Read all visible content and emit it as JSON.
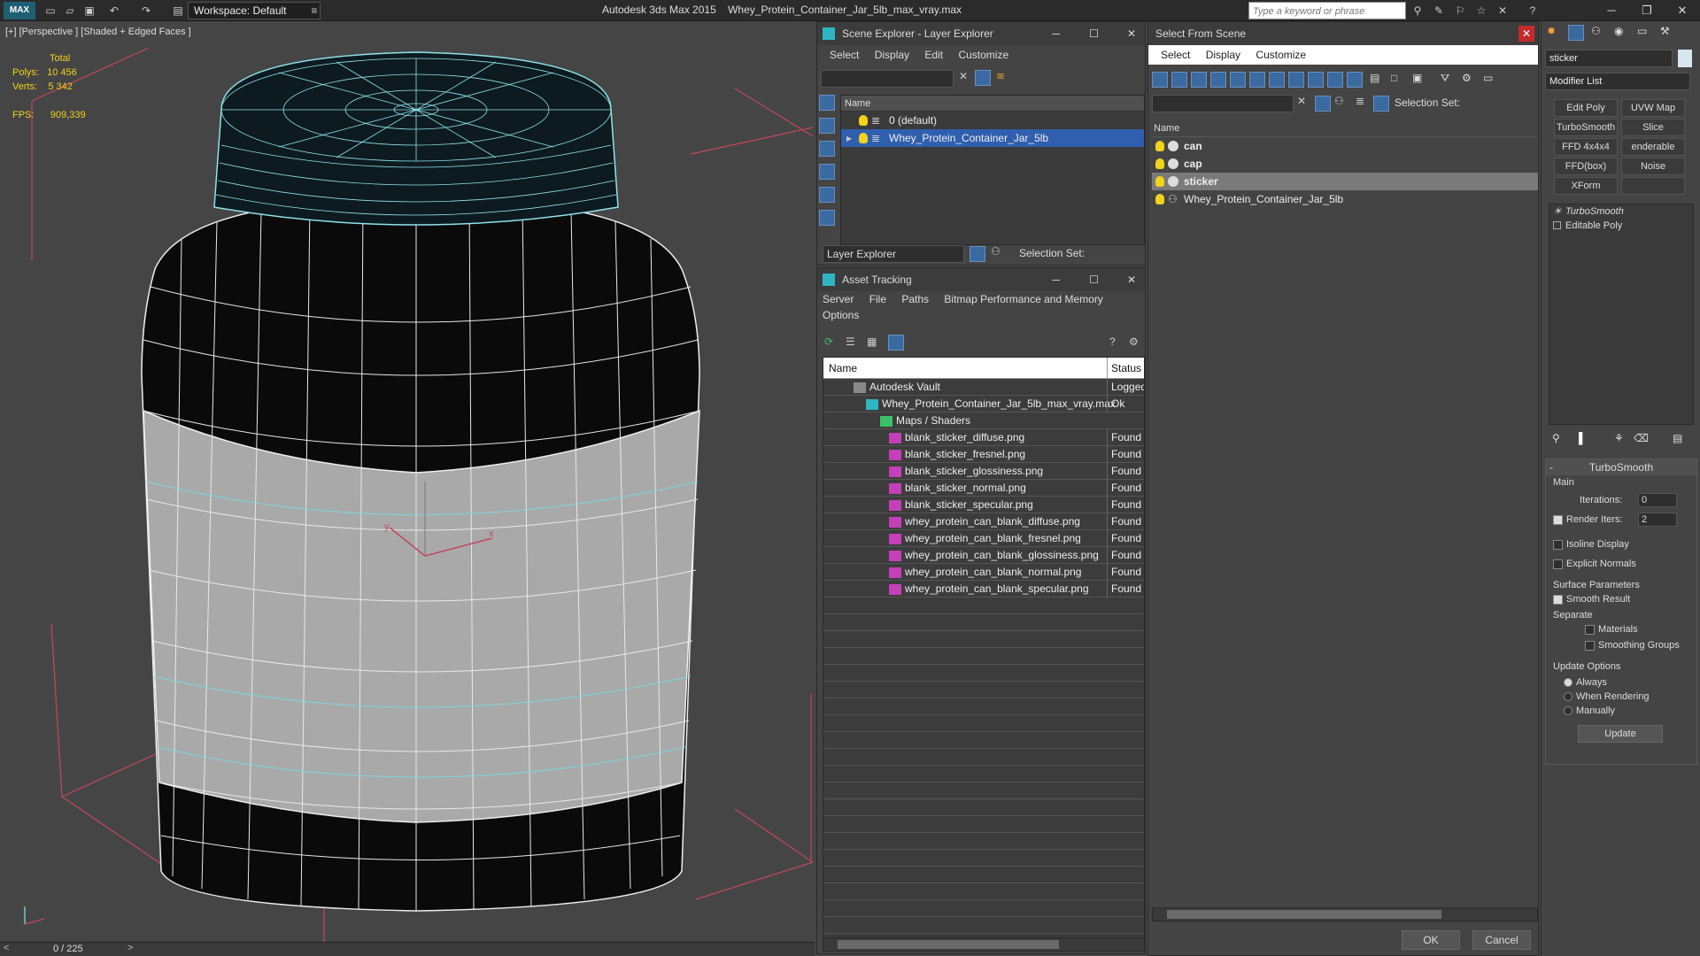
{
  "titlebar": {
    "logo": "MAX",
    "workspace": "Workspace: Default",
    "app": "Autodesk 3ds Max  2015",
    "file": "Whey_Protein_Container_Jar_5lb_max_vray.max",
    "search_placeholder": "Type a keyword or phrase"
  },
  "viewport": {
    "label": "[+] [Perspective ] [Shaded + Edged Faces ]",
    "stats_total": "Total",
    "polys_label": "Polys:",
    "polys_value": "10 456",
    "verts_label": "Verts:",
    "verts_value": "5 342",
    "fps_label": "FPS:",
    "fps_value": "909,339",
    "axis_x": "x",
    "axis_y": "y"
  },
  "timeline": {
    "frame": "0 / 225"
  },
  "scene_explorer": {
    "title": "Scene Explorer - Layer Explorer",
    "menu": [
      "Select",
      "Display",
      "Edit",
      "Customize"
    ],
    "column": "Name",
    "rows": [
      "0 (default)",
      "Whey_Protein_Container_Jar_5lb"
    ],
    "bottom_label": "Layer Explorer",
    "selection_set": "Selection Set:"
  },
  "asset_tracking": {
    "title": "Asset Tracking",
    "menu": [
      "Server",
      "File",
      "Paths",
      "Bitmap Performance and Memory"
    ],
    "menu2": "Options",
    "col_name": "Name",
    "col_status": "Status",
    "rows": [
      {
        "name": "Autodesk Vault",
        "status": "Logged",
        "indent": 34
      },
      {
        "name": "Whey_Protein_Container_Jar_5lb_max_vray.max",
        "status": "Ok",
        "indent": 48
      },
      {
        "name": "Maps / Shaders",
        "status": "",
        "indent": 64
      },
      {
        "name": "blank_sticker_diffuse.png",
        "status": "Found",
        "indent": 74
      },
      {
        "name": "blank_sticker_fresnel.png",
        "status": "Found",
        "indent": 74
      },
      {
        "name": "blank_sticker_glossiness.png",
        "status": "Found",
        "indent": 74
      },
      {
        "name": "blank_sticker_normal.png",
        "status": "Found",
        "indent": 74
      },
      {
        "name": "blank_sticker_specular.png",
        "status": "Found",
        "indent": 74
      },
      {
        "name": "whey_protein_can_blank_diffuse.png",
        "status": "Found",
        "indent": 74
      },
      {
        "name": "whey_protein_can_blank_fresnel.png",
        "status": "Found",
        "indent": 74
      },
      {
        "name": "whey_protein_can_blank_glossiness.png",
        "status": "Found",
        "indent": 74
      },
      {
        "name": "whey_protein_can_blank_normal.png",
        "status": "Found",
        "indent": 74
      },
      {
        "name": "whey_protein_can_blank_specular.png",
        "status": "Found",
        "indent": 74
      }
    ]
  },
  "select_from_scene": {
    "title": "Select From Scene",
    "menu": [
      "Select",
      "Display",
      "Customize"
    ],
    "selection_set": "Selection Set:",
    "column": "Name",
    "rows": [
      "can",
      "cap",
      "sticker",
      "Whey_Protein_Container_Jar_5lb"
    ],
    "ok": "OK",
    "cancel": "Cancel"
  },
  "command_panel": {
    "object_name": "sticker",
    "modifier_list": "Modifier List",
    "buttons": [
      "Edit Poly",
      "UVW Map",
      "TurboSmooth",
      "Slice",
      "FFD 4x4x4",
      "enderable Splir",
      "FFD(box)",
      "Noise",
      "XForm",
      ""
    ],
    "stack": [
      "TurboSmooth",
      "Editable Poly"
    ],
    "rollout_title": "TurboSmooth",
    "main_label": "Main",
    "iterations_label": "Iterations:",
    "iterations_value": "0",
    "render_iters_label": "Render Iters:",
    "render_iters_value": "2",
    "isoline": "Isoline Display",
    "explicit": "Explicit Normals",
    "surface_params": "Surface Parameters",
    "smooth_result": "Smooth Result",
    "separate": "Separate",
    "materials": "Materials",
    "smoothing_groups": "Smoothing Groups",
    "update_options": "Update Options",
    "always": "Always",
    "when_rendering": "When Rendering",
    "manually": "Manually",
    "update": "Update"
  }
}
